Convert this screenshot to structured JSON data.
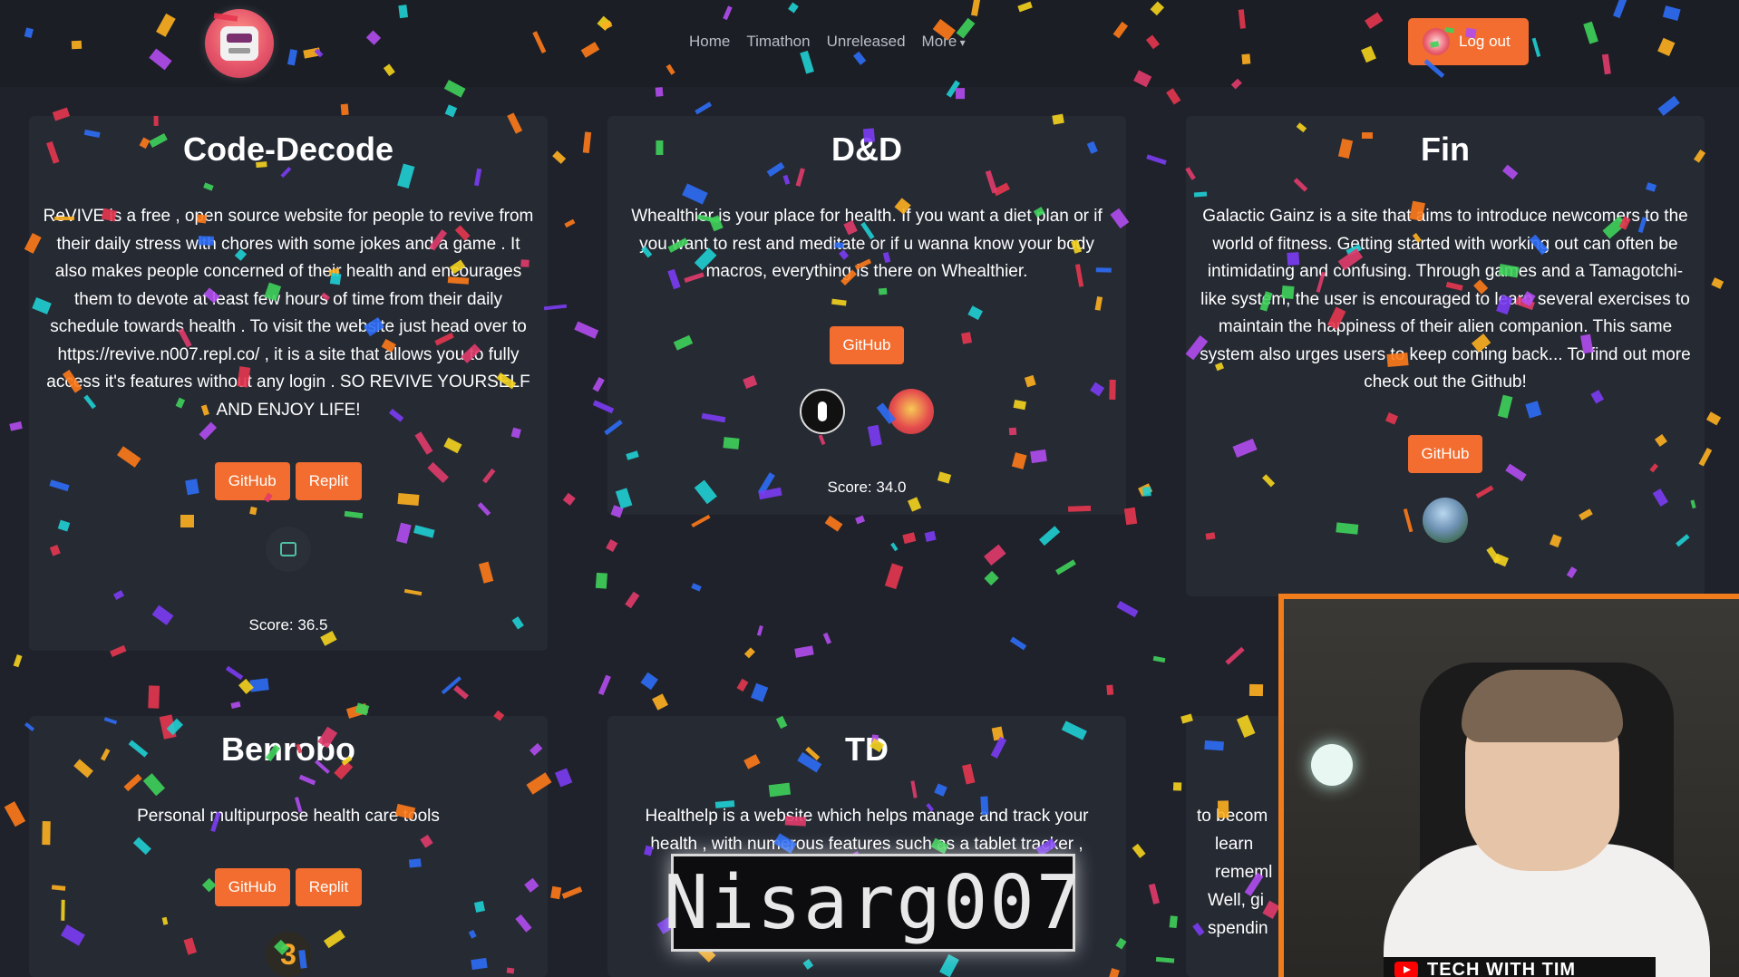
{
  "nav": {
    "links": [
      "Home",
      "Timathon",
      "Unreleased",
      "More"
    ],
    "logout_label": "Log out"
  },
  "cards": [
    {
      "title": "Code-Decode",
      "description": "ReVIVE is a free , open source website for people to revive from their daily stress with chores with some jokes and a game . It also makes people concerned of their health and encourages them to devote at least few hours of time from their daily schedule towards health . To visit the website just head over to https://revive.n007.repl.co/ , it is a site that allows you to fully access it's features without any login . SO REVIVE YOURSELF AND ENJOY LIFE!",
      "buttons": [
        "GitHub",
        "Replit"
      ],
      "score": "Score: 36.5"
    },
    {
      "title": "D&D",
      "description": "Whealthier is your place for health. If you want a diet plan or if you want to rest and meditate or if u wanna know your body macros, everything is there on Whealthier.",
      "buttons": [
        "GitHub"
      ],
      "score": "Score: 34.0"
    },
    {
      "title": "Fin",
      "description": "Galactic Gainz is a site that aims to introduce newcomers to the world of fitness. Getting started with working out can often be intimidating and confusing. Through games and a Tamagotchi-like system, the user is encouraged to learn several exercises to maintain the happiness of their alien companion. This same system also urges users to keep coming back... To find out more check out the Github!",
      "buttons": [
        "GitHub"
      ]
    },
    {
      "title": "Benrobo",
      "description": "Personal multipurpose health care tools",
      "buttons": [
        "GitHub",
        "Replit"
      ]
    },
    {
      "title": "TD",
      "description": "Healthelp is a website which helps manage and track your health , with numerous features such as a tablet tracker ,"
    }
  ],
  "partial_card_text": [
    "to becom",
    "learn",
    "rememl",
    "Well, gi",
    "spendin"
  ],
  "overlay_name": "Nisarg007",
  "webcam_banner": "TECH WITH TIM",
  "colors": {
    "accent": "#f26d2f",
    "background": "#1f222a",
    "card": "#262a33",
    "webcam_border": "#f07c1c"
  }
}
